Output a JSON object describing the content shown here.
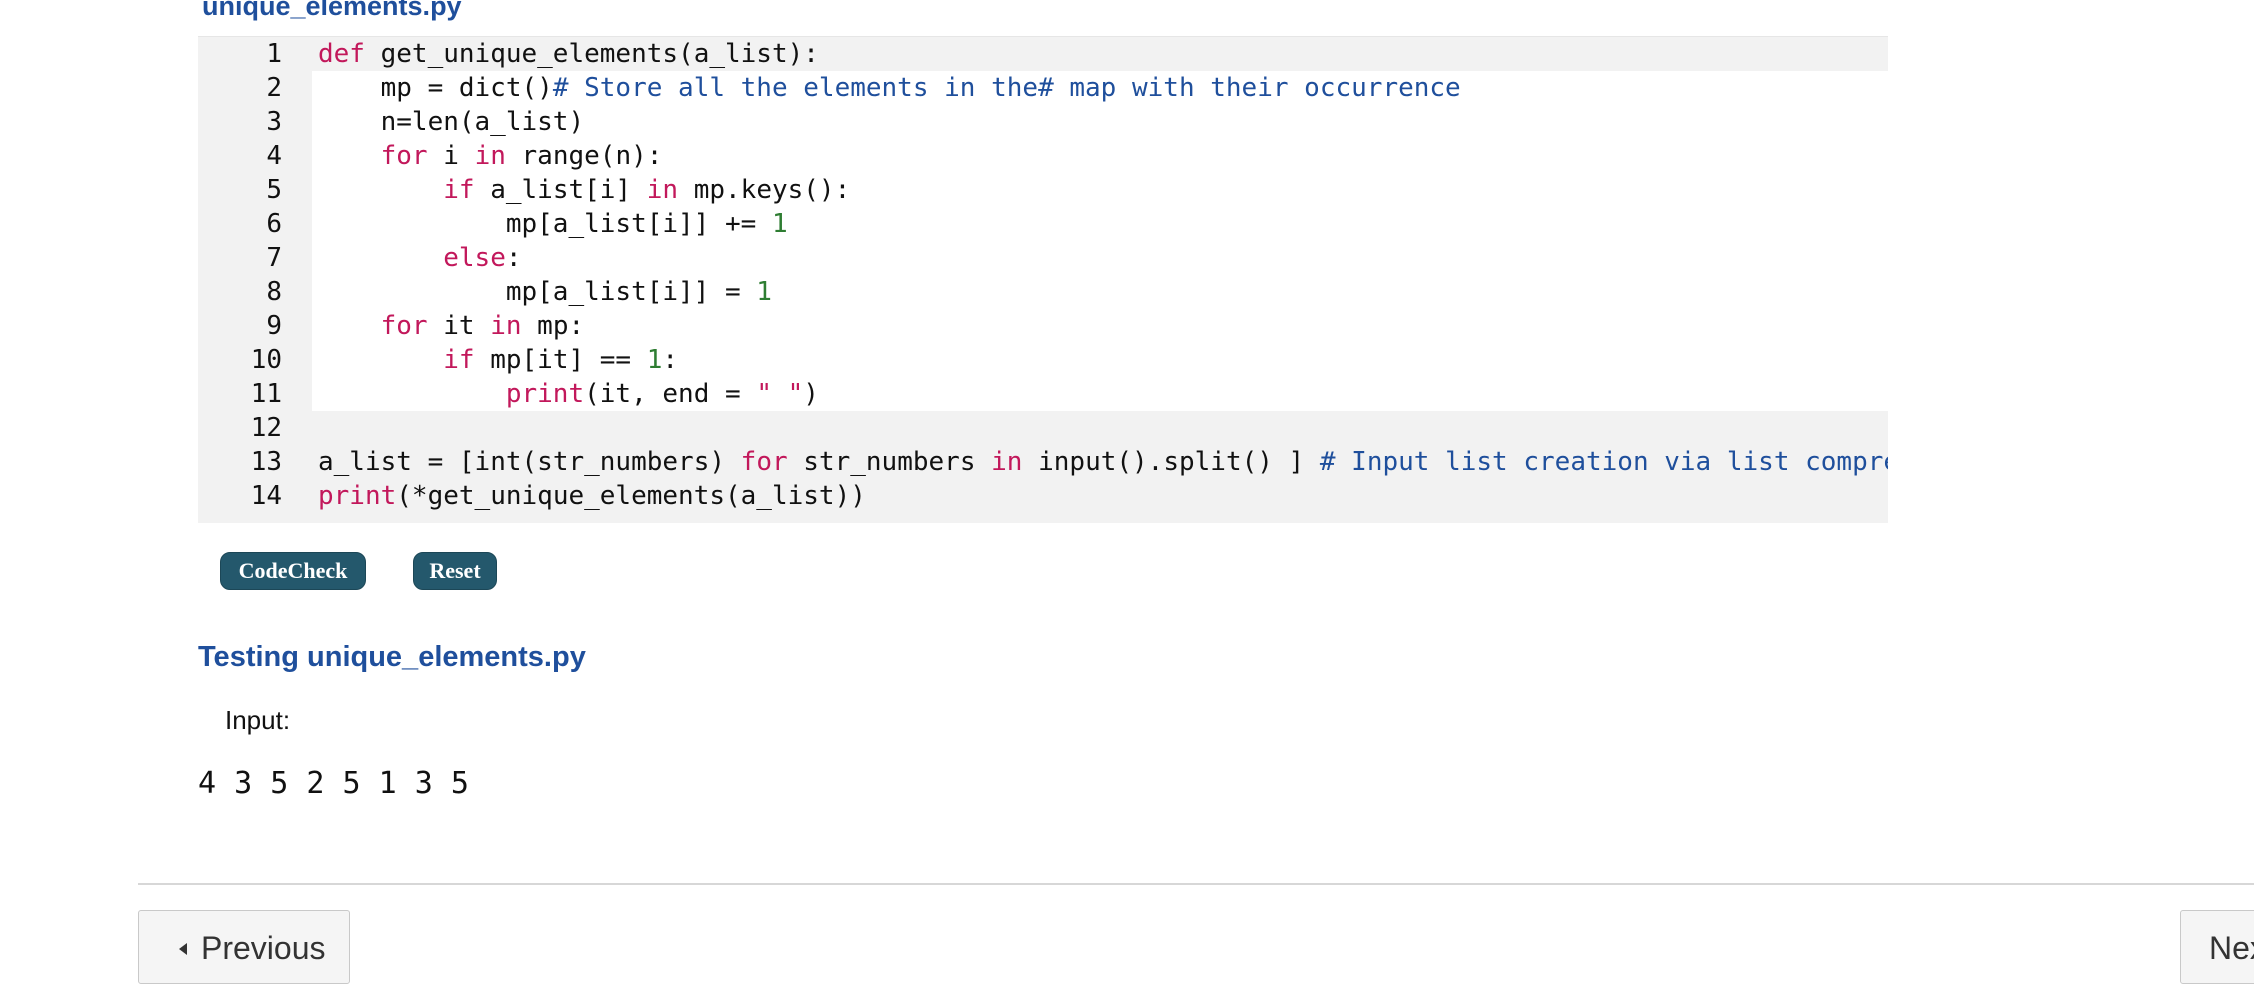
{
  "file_title": "unique_elements.py",
  "editor": {
    "lines": [
      {
        "n": "1",
        "tokens": [
          {
            "t": "def",
            "c": "kw"
          },
          {
            "t": " get_unique_elements(a_list):",
            "c": "tx"
          }
        ]
      },
      {
        "n": "2",
        "tokens": [
          {
            "t": "    mp = dict()",
            "c": "tx"
          },
          {
            "t": "# Store all the elements in the# map with their occurrence",
            "c": "cm"
          }
        ]
      },
      {
        "n": "3",
        "tokens": [
          {
            "t": "    n=len(a_list)",
            "c": "tx"
          }
        ]
      },
      {
        "n": "4",
        "tokens": [
          {
            "t": "    ",
            "c": "tx"
          },
          {
            "t": "for",
            "c": "kw"
          },
          {
            "t": " i ",
            "c": "tx"
          },
          {
            "t": "in",
            "c": "kw"
          },
          {
            "t": " range(n):",
            "c": "tx"
          }
        ]
      },
      {
        "n": "5",
        "tokens": [
          {
            "t": "        ",
            "c": "tx"
          },
          {
            "t": "if",
            "c": "kw"
          },
          {
            "t": " a_list[i] ",
            "c": "tx"
          },
          {
            "t": "in",
            "c": "kw"
          },
          {
            "t": " mp.keys():",
            "c": "tx"
          }
        ]
      },
      {
        "n": "6",
        "tokens": [
          {
            "t": "            mp[a_list[i]] += ",
            "c": "tx"
          },
          {
            "t": "1",
            "c": "num"
          }
        ]
      },
      {
        "n": "7",
        "tokens": [
          {
            "t": "        ",
            "c": "tx"
          },
          {
            "t": "else",
            "c": "kw"
          },
          {
            "t": ":",
            "c": "tx"
          }
        ]
      },
      {
        "n": "8",
        "tokens": [
          {
            "t": "            mp[a_list[i]] = ",
            "c": "tx"
          },
          {
            "t": "1",
            "c": "num"
          }
        ]
      },
      {
        "n": "9",
        "tokens": [
          {
            "t": "    ",
            "c": "tx"
          },
          {
            "t": "for",
            "c": "kw"
          },
          {
            "t": " it ",
            "c": "tx"
          },
          {
            "t": "in",
            "c": "kw"
          },
          {
            "t": " mp:",
            "c": "tx"
          }
        ]
      },
      {
        "n": "10",
        "tokens": [
          {
            "t": "        ",
            "c": "tx"
          },
          {
            "t": "if",
            "c": "kw"
          },
          {
            "t": " mp[it] == ",
            "c": "tx"
          },
          {
            "t": "1",
            "c": "num"
          },
          {
            "t": ":",
            "c": "tx"
          }
        ]
      },
      {
        "n": "11",
        "tokens": [
          {
            "t": "            ",
            "c": "tx"
          },
          {
            "t": "print",
            "c": "bi"
          },
          {
            "t": "(it, end = ",
            "c": "tx"
          },
          {
            "t": "\" \"",
            "c": "str"
          },
          {
            "t": ")",
            "c": "tx"
          }
        ]
      },
      {
        "n": "12",
        "tokens": []
      },
      {
        "n": "13",
        "tokens": [
          {
            "t": "a_list = [",
            "c": "tx"
          },
          {
            "t": "int",
            "c": "tx"
          },
          {
            "t": "(str_numbers) ",
            "c": "tx"
          },
          {
            "t": "for",
            "c": "kw"
          },
          {
            "t": " str_numbers ",
            "c": "tx"
          },
          {
            "t": "in",
            "c": "kw"
          },
          {
            "t": " input().split() ] ",
            "c": "tx"
          },
          {
            "t": "# Input list creation via list comprehension",
            "c": "cm"
          }
        ]
      },
      {
        "n": "14",
        "tokens": [
          {
            "t": "print",
            "c": "bi"
          },
          {
            "t": "(*get_unique_elements(a_list))",
            "c": "tx"
          }
        ]
      }
    ]
  },
  "buttons": {
    "codecheck_label": "CodeCheck",
    "reset_label": "Reset"
  },
  "testing": {
    "title": "Testing unique_elements.py",
    "input_label": "Input:",
    "input_value": "4 3 5 2 5 1 3 5"
  },
  "nav": {
    "previous_label": "Previous",
    "next_label": "Next"
  },
  "colors": {
    "accent_blue": "#1f4f9c",
    "button_teal": "#24586c",
    "keyword": "#c2185b",
    "number": "#2e7d32"
  }
}
